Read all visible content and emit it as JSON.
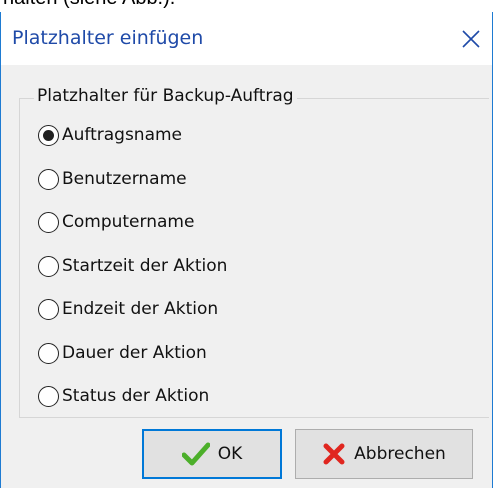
{
  "background_snippet": "halten (siehe Abb.).",
  "dialog": {
    "title": "Platzhalter einfügen",
    "group_label": "Platzhalter für Backup-Auftrag",
    "options": [
      {
        "label": "Auftragsname",
        "selected": true
      },
      {
        "label": "Benutzername",
        "selected": false
      },
      {
        "label": "Computername",
        "selected": false
      },
      {
        "label": "Startzeit der Aktion",
        "selected": false
      },
      {
        "label": "Endzeit der Aktion",
        "selected": false
      },
      {
        "label": "Dauer der Aktion",
        "selected": false
      },
      {
        "label": "Status der Aktion",
        "selected": false
      }
    ],
    "buttons": {
      "ok_label": "OK",
      "cancel_label": "Abbrechen"
    }
  },
  "colors": {
    "title_text": "#1f4aa8",
    "window_border": "#1e7bd2",
    "ok_check": "#4caf2a",
    "cancel_x": "#e0261f"
  },
  "icons": {
    "close": "close-icon",
    "ok": "check-icon",
    "cancel": "red-x-icon"
  }
}
